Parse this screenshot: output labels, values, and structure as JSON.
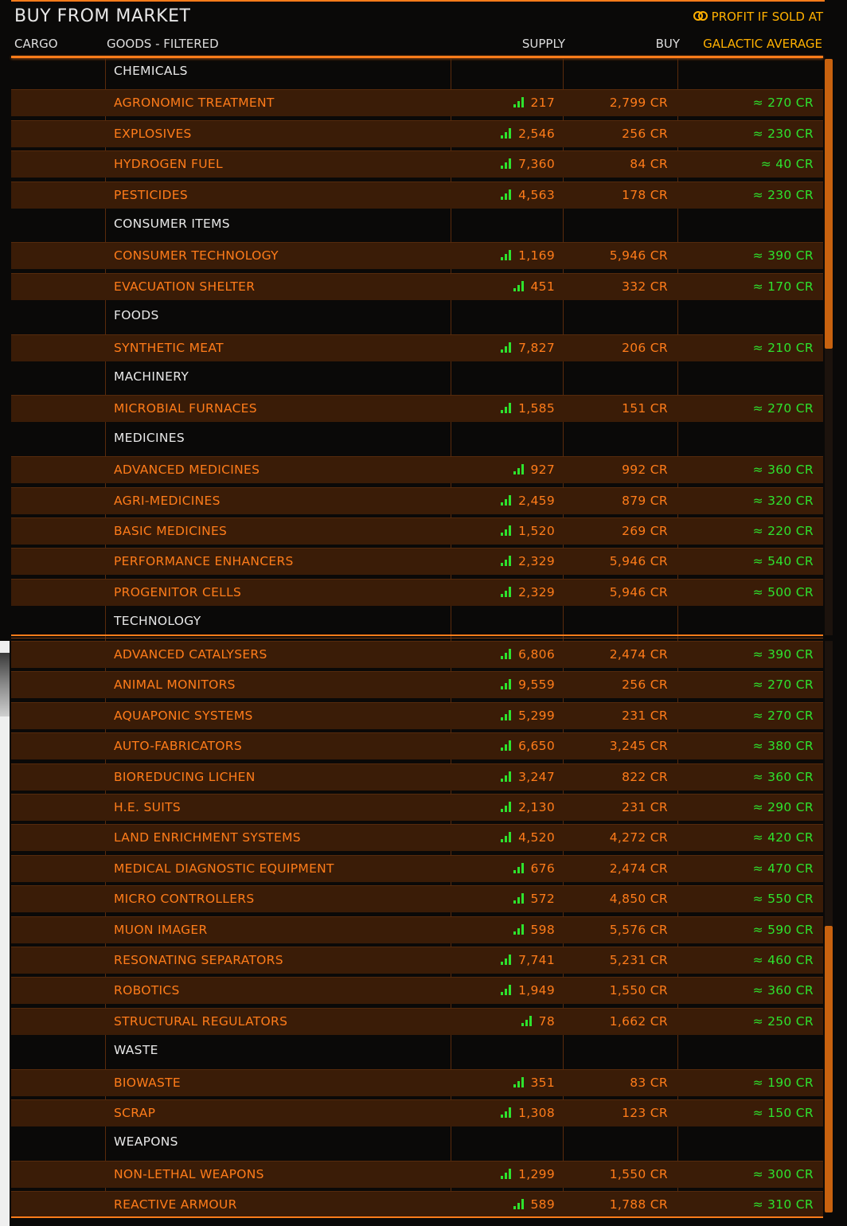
{
  "title": "BUY FROM MARKET",
  "profit_label": "PROFIT IF SOLD AT",
  "headers": {
    "cargo": "CARGO",
    "goods": "GOODS - FILTERED",
    "supply": "SUPPLY",
    "buy": "BUY",
    "galactic_average": "GALACTIC AVERAGE"
  },
  "colors": {
    "accent": "#ff7c1a",
    "profit": "#ffb000",
    "positive": "#2ee22e",
    "row_bg": "#3a1c07"
  },
  "rows": [
    {
      "type": "category",
      "name": "CHEMICALS"
    },
    {
      "type": "item",
      "name": "AGRONOMIC TREATMENT",
      "supply": "217",
      "buy": "2,799 CR",
      "avg": "≈ 270 CR"
    },
    {
      "type": "item",
      "name": "EXPLOSIVES",
      "supply": "2,546",
      "buy": "256 CR",
      "avg": "≈ 230 CR"
    },
    {
      "type": "item",
      "name": "HYDROGEN FUEL",
      "supply": "7,360",
      "buy": "84 CR",
      "avg": "≈ 40 CR"
    },
    {
      "type": "item",
      "name": "PESTICIDES",
      "supply": "4,563",
      "buy": "178 CR",
      "avg": "≈ 230 CR"
    },
    {
      "type": "category",
      "name": "CONSUMER ITEMS"
    },
    {
      "type": "item",
      "name": "CONSUMER TECHNOLOGY",
      "supply": "1,169",
      "buy": "5,946 CR",
      "avg": "≈ 390 CR"
    },
    {
      "type": "item",
      "name": "EVACUATION SHELTER",
      "supply": "451",
      "buy": "332 CR",
      "avg": "≈ 170 CR"
    },
    {
      "type": "category",
      "name": "FOODS"
    },
    {
      "type": "item",
      "name": "SYNTHETIC MEAT",
      "supply": "7,827",
      "buy": "206 CR",
      "avg": "≈ 210 CR"
    },
    {
      "type": "category",
      "name": "MACHINERY"
    },
    {
      "type": "item",
      "name": "MICROBIAL FURNACES",
      "supply": "1,585",
      "buy": "151 CR",
      "avg": "≈ 270 CR"
    },
    {
      "type": "category",
      "name": "MEDICINES"
    },
    {
      "type": "item",
      "name": "ADVANCED MEDICINES",
      "supply": "927",
      "buy": "992 CR",
      "avg": "≈ 360 CR"
    },
    {
      "type": "item",
      "name": "AGRI-MEDICINES",
      "supply": "2,459",
      "buy": "879 CR",
      "avg": "≈ 320 CR"
    },
    {
      "type": "item",
      "name": "BASIC MEDICINES",
      "supply": "1,520",
      "buy": "269 CR",
      "avg": "≈ 220 CR"
    },
    {
      "type": "item",
      "name": "PERFORMANCE ENHANCERS",
      "supply": "2,329",
      "buy": "5,946 CR",
      "avg": "≈ 540 CR"
    },
    {
      "type": "item",
      "name": "PROGENITOR CELLS",
      "supply": "2,329",
      "buy": "5,946 CR",
      "avg": "≈ 500 CR"
    },
    {
      "type": "category",
      "name": "TECHNOLOGY"
    },
    {
      "type": "item",
      "name": "ADVANCED CATALYSERS",
      "supply": "6,806",
      "buy": "2,474 CR",
      "avg": "≈ 390 CR"
    },
    {
      "type": "item",
      "name": "ANIMAL MONITORS",
      "supply": "9,559",
      "buy": "256 CR",
      "avg": "≈ 270 CR"
    },
    {
      "type": "item",
      "name": "AQUAPONIC SYSTEMS",
      "supply": "5,299",
      "buy": "231 CR",
      "avg": "≈ 270 CR"
    },
    {
      "type": "item",
      "name": "AUTO-FABRICATORS",
      "supply": "6,650",
      "buy": "3,245 CR",
      "avg": "≈ 380 CR"
    },
    {
      "type": "item",
      "name": "BIOREDUCING LICHEN",
      "supply": "3,247",
      "buy": "822 CR",
      "avg": "≈ 360 CR"
    },
    {
      "type": "item",
      "name": "H.E. SUITS",
      "supply": "2,130",
      "buy": "231 CR",
      "avg": "≈ 290 CR"
    },
    {
      "type": "item",
      "name": "LAND ENRICHMENT SYSTEMS",
      "supply": "4,520",
      "buy": "4,272 CR",
      "avg": "≈ 420 CR"
    },
    {
      "type": "item",
      "name": "MEDICAL DIAGNOSTIC EQUIPMENT",
      "supply": "676",
      "buy": "2,474 CR",
      "avg": "≈ 470 CR"
    },
    {
      "type": "item",
      "name": "MICRO CONTROLLERS",
      "supply": "572",
      "buy": "4,850 CR",
      "avg": "≈ 550 CR"
    },
    {
      "type": "item",
      "name": "MUON IMAGER",
      "supply": "598",
      "buy": "5,576 CR",
      "avg": "≈ 590 CR"
    },
    {
      "type": "item",
      "name": "RESONATING SEPARATORS",
      "supply": "7,741",
      "buy": "5,231 CR",
      "avg": "≈ 460 CR"
    },
    {
      "type": "item",
      "name": "ROBOTICS",
      "supply": "1,949",
      "buy": "1,550 CR",
      "avg": "≈ 360 CR"
    },
    {
      "type": "item",
      "name": "STRUCTURAL REGULATORS",
      "supply": "78",
      "buy": "1,662 CR",
      "avg": "≈ 250 CR"
    },
    {
      "type": "category",
      "name": "WASTE"
    },
    {
      "type": "item",
      "name": "BIOWASTE",
      "supply": "351",
      "buy": "83 CR",
      "avg": "≈ 190 CR"
    },
    {
      "type": "item",
      "name": "SCRAP",
      "supply": "1,308",
      "buy": "123 CR",
      "avg": "≈ 150 CR"
    },
    {
      "type": "category",
      "name": "WEAPONS"
    },
    {
      "type": "item",
      "name": "NON-LETHAL WEAPONS",
      "supply": "1,299",
      "buy": "1,550 CR",
      "avg": "≈ 300 CR"
    },
    {
      "type": "item",
      "name": "REACTIVE ARMOUR",
      "supply": "589",
      "buy": "1,788 CR",
      "avg": "≈ 310 CR"
    }
  ]
}
